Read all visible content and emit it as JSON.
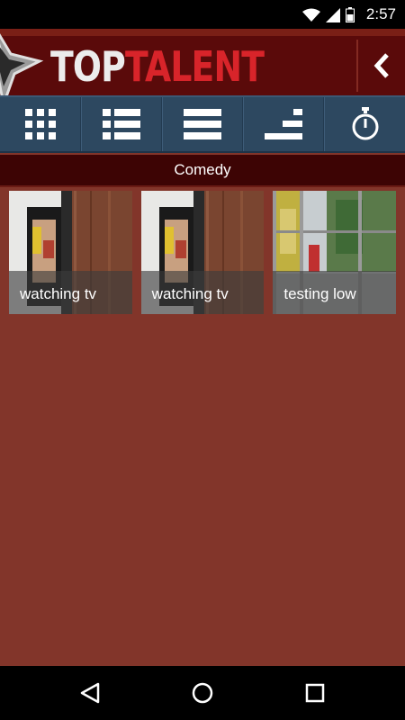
{
  "status_bar": {
    "time": "2:57"
  },
  "header": {
    "logo_top": "TOP",
    "logo_talent": "TALENT"
  },
  "category": {
    "title": "Comedy"
  },
  "videos": [
    {
      "title": "watching tv",
      "thumbnail": "tv-image"
    },
    {
      "title": "watching tv",
      "thumbnail": "tv-image"
    },
    {
      "title": "testing low",
      "thumbnail": "window-image"
    }
  ],
  "toolbar_icons": [
    "grid-icon",
    "list-icon",
    "rows-icon",
    "sort-icon",
    "timer-icon"
  ],
  "colors": {
    "background": "#82352a",
    "header": "#5a0a0a",
    "toolbar": "#2d4860",
    "category_bar": "#3d0404",
    "logo_accent": "#d8242a"
  }
}
